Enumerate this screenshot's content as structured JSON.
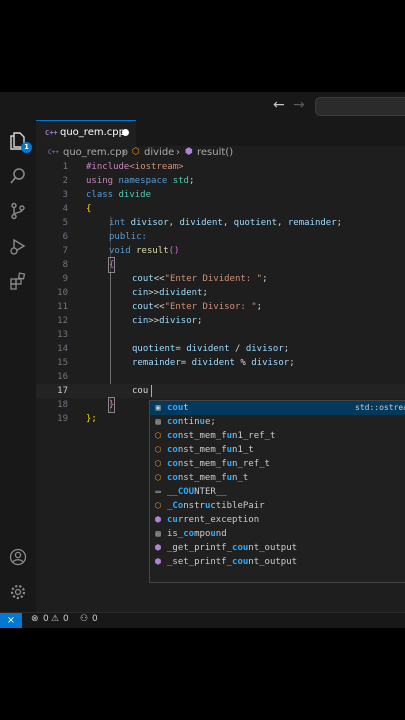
{
  "tab": {
    "label": "quo_rem.cpp",
    "icon": "C++"
  },
  "activity": {
    "explorer_badge": "1"
  },
  "breadcrumb": {
    "file": "quo_rem.cpp",
    "sep": "›",
    "class": "divide",
    "method": "result()"
  },
  "editor": {
    "line_numbers": [
      "1",
      "2",
      "3",
      "4",
      "5",
      "6",
      "7",
      "8",
      "9",
      "10",
      "11",
      "12",
      "13",
      "14",
      "15",
      "16",
      "17",
      "18",
      "19"
    ],
    "active_line": "17",
    "lines": {
      "l1": {
        "a": "#include",
        "b": "<iostream>"
      },
      "l2": {
        "a": "using",
        "b": " namespace",
        "c": " std",
        "d": ";"
      },
      "l3": {
        "a": "class",
        "b": " divide"
      },
      "l4": {
        "a": "{"
      },
      "l5": {
        "a": "int",
        "b": " divisor",
        "c": ", ",
        "d": "divident",
        "e": ", ",
        "f": "quotient",
        "g": ", ",
        "h": "remainder",
        "i": ";"
      },
      "l6": {
        "a": "public:"
      },
      "l7": {
        "a": "void",
        "b": " result",
        "c": "()"
      },
      "l8": {
        "a": "{"
      },
      "l9": {
        "a": "cout",
        "b": "<<",
        "c": "\"Enter Divident: \"",
        "d": ";"
      },
      "l10": {
        "a": "cin",
        "b": ">>",
        "c": "divident",
        "d": ";"
      },
      "l11": {
        "a": "cout",
        "b": "<<",
        "c": "\"Enter Divisor: \"",
        "d": ";"
      },
      "l12": {
        "a": "cin",
        "b": ">>",
        "c": "divisor",
        "d": ";"
      },
      "l14": {
        "a": "quotient",
        "b": "= ",
        "c": "divident",
        "d": " / ",
        "e": "divisor",
        "f": ";"
      },
      "l15": {
        "a": "remainder",
        "b": "= ",
        "c": "divident",
        "d": " % ",
        "e": "divisor",
        "f": ";"
      },
      "l17": {
        "a": "cou"
      },
      "l18": {
        "a": "}"
      },
      "l19": {
        "a": "};"
      }
    }
  },
  "suggestions": [
    {
      "match": "cou",
      "rest": "t",
      "icon": "snippet-icon",
      "detail": "std::ostream std::cout"
    },
    {
      "match": "co",
      "mid": "ntin",
      "m2": "u",
      "rest": "e;",
      "icon": "snippet-icon"
    },
    {
      "match": "co",
      "mid": "nst_mem_f",
      "m2": "u",
      "rest": "n1_ref_t",
      "icon": "class-icon"
    },
    {
      "match": "co",
      "mid": "nst_mem_f",
      "m2": "u",
      "rest": "n1_t",
      "icon": "class-icon"
    },
    {
      "match": "co",
      "mid": "nst_mem_f",
      "m2": "u",
      "rest": "n_ref_t",
      "icon": "class-icon"
    },
    {
      "match": "co",
      "mid": "nst_mem_f",
      "m2": "u",
      "rest": "n_t",
      "icon": "class-icon"
    },
    {
      "pre": "__",
      "match": "COU",
      "rest": "NTER__",
      "icon": "keyword-icon"
    },
    {
      "pre": "_",
      "match": "Co",
      "mid": "nstr",
      "m2": "u",
      "rest": "ctiblePair",
      "icon": "class-icon"
    },
    {
      "pre": "",
      "match": "cu",
      "mid": "rrent_exception",
      "rest": "",
      "icon": "method-icon",
      "plain": true
    },
    {
      "pre": "is_",
      "match": "co",
      "mid": "mpo",
      "m2": "u",
      "rest": "nd",
      "icon": "snippet-icon"
    },
    {
      "pre": "_get_printf_",
      "match": "cou",
      "rest": "nt_output",
      "icon": "method-icon"
    },
    {
      "pre": "_set_printf_",
      "match": "cou",
      "rest": "nt_output",
      "icon": "method-icon"
    }
  ],
  "status": {
    "remote": "⨯",
    "errors": "0",
    "warnings": "0",
    "ports": "0"
  },
  "colors": {
    "accent": "#0078d4",
    "editor_bg": "#1e1e1e",
    "selection": "#04395e"
  }
}
